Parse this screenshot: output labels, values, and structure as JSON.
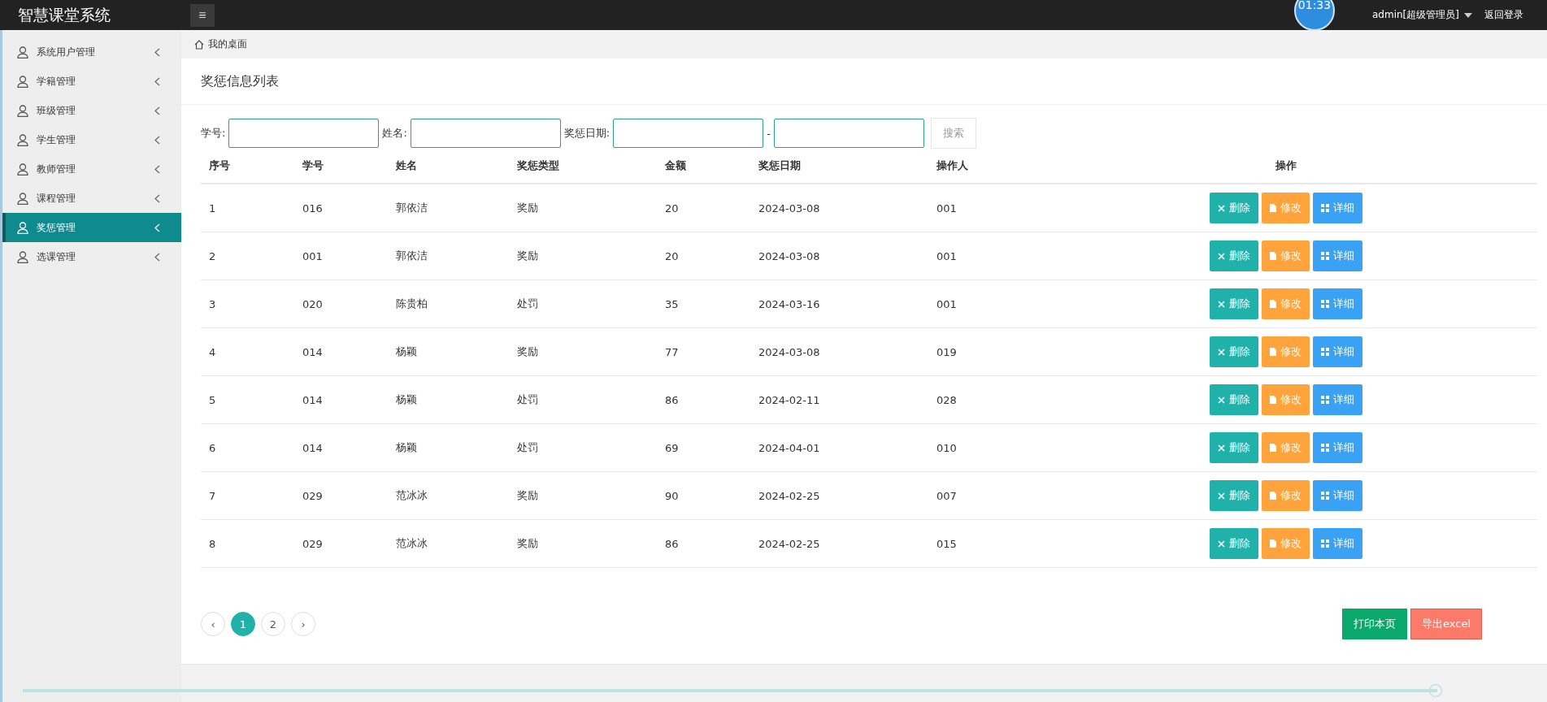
{
  "header": {
    "title": "智慧课堂系统",
    "menu_glyph": "≡",
    "clock": "01:33",
    "user": "admin[超级管理员]",
    "logout": "返回登录"
  },
  "sidebar": {
    "items": [
      {
        "label": "系统用户管理",
        "selected": false
      },
      {
        "label": "学籍管理",
        "selected": false
      },
      {
        "label": "班级管理",
        "selected": false
      },
      {
        "label": "学生管理",
        "selected": false
      },
      {
        "label": "教师管理",
        "selected": false
      },
      {
        "label": "课程管理",
        "selected": false
      },
      {
        "label": "奖惩管理",
        "selected": true
      },
      {
        "label": "选课管理",
        "selected": false
      }
    ]
  },
  "breadcrumb": "我的桌面",
  "page_title": "奖惩信息列表",
  "search": {
    "fields": [
      {
        "label": "学号:"
      },
      {
        "label": "姓名:"
      },
      {
        "label": "奖惩日期:"
      }
    ],
    "range_separator": "-",
    "button": "搜索"
  },
  "table": {
    "columns": [
      "序号",
      "学号",
      "姓名",
      "奖惩类型",
      "金额",
      "奖惩日期",
      "操作人",
      "操作"
    ],
    "rows": [
      {
        "cells": [
          "1",
          "016",
          "郭依洁",
          "奖励",
          "20",
          "2024-03-08",
          "001"
        ],
        "actions": [
          {
            "kind": "delete",
            "label": "删除"
          },
          {
            "kind": "edit",
            "label": "修改"
          },
          {
            "kind": "detail",
            "label": "详细"
          }
        ]
      },
      {
        "cells": [
          "2",
          "001",
          "郭依洁",
          "奖励",
          "20",
          "2024-03-08",
          "001"
        ],
        "actions": [
          {
            "kind": "delete",
            "label": "删除"
          },
          {
            "kind": "edit",
            "label": "修改"
          },
          {
            "kind": "detail",
            "label": "详细"
          }
        ]
      },
      {
        "cells": [
          "3",
          "020",
          "陈贵柏",
          "处罚",
          "35",
          "2024-03-16",
          "001"
        ],
        "actions": [
          {
            "kind": "delete",
            "label": "删除"
          },
          {
            "kind": "edit",
            "label": "修改"
          },
          {
            "kind": "detail",
            "label": "详细"
          }
        ]
      },
      {
        "cells": [
          "4",
          "014",
          "杨颖",
          "奖励",
          "77",
          "2024-03-08",
          "019"
        ],
        "actions": [
          {
            "kind": "delete",
            "label": "删除"
          },
          {
            "kind": "edit",
            "label": "修改"
          },
          {
            "kind": "detail",
            "label": "详细"
          }
        ]
      },
      {
        "cells": [
          "5",
          "014",
          "杨颖",
          "处罚",
          "86",
          "2024-02-11",
          "028"
        ],
        "actions": [
          {
            "kind": "delete",
            "label": "删除"
          },
          {
            "kind": "edit",
            "label": "修改"
          },
          {
            "kind": "detail",
            "label": "详细"
          }
        ]
      },
      {
        "cells": [
          "6",
          "014",
          "杨颖",
          "处罚",
          "69",
          "2024-04-01",
          "010"
        ],
        "actions": [
          {
            "kind": "delete",
            "label": "删除"
          },
          {
            "kind": "edit",
            "label": "修改"
          },
          {
            "kind": "detail",
            "label": "详细"
          }
        ]
      },
      {
        "cells": [
          "7",
          "029",
          "范冰冰",
          "奖励",
          "90",
          "2024-02-25",
          "007"
        ],
        "actions": [
          {
            "kind": "delete",
            "label": "删除"
          },
          {
            "kind": "edit",
            "label": "修改"
          },
          {
            "kind": "detail",
            "label": "详细"
          }
        ]
      },
      {
        "cells": [
          "8",
          "029",
          "范冰冰",
          "奖励",
          "86",
          "2024-02-25",
          "015"
        ],
        "actions": [
          {
            "kind": "delete",
            "label": "删除"
          },
          {
            "kind": "edit",
            "label": "修改"
          },
          {
            "kind": "detail",
            "label": "详细"
          }
        ]
      }
    ]
  },
  "pagination": {
    "prev": "‹",
    "pages": [
      {
        "label": "1",
        "selected": true
      },
      {
        "label": "2",
        "selected": false
      }
    ],
    "next": "›"
  },
  "footer_buttons": [
    {
      "kind": "print",
      "label": "打印本页"
    },
    {
      "kind": "export",
      "label": "导出excel"
    }
  ]
}
